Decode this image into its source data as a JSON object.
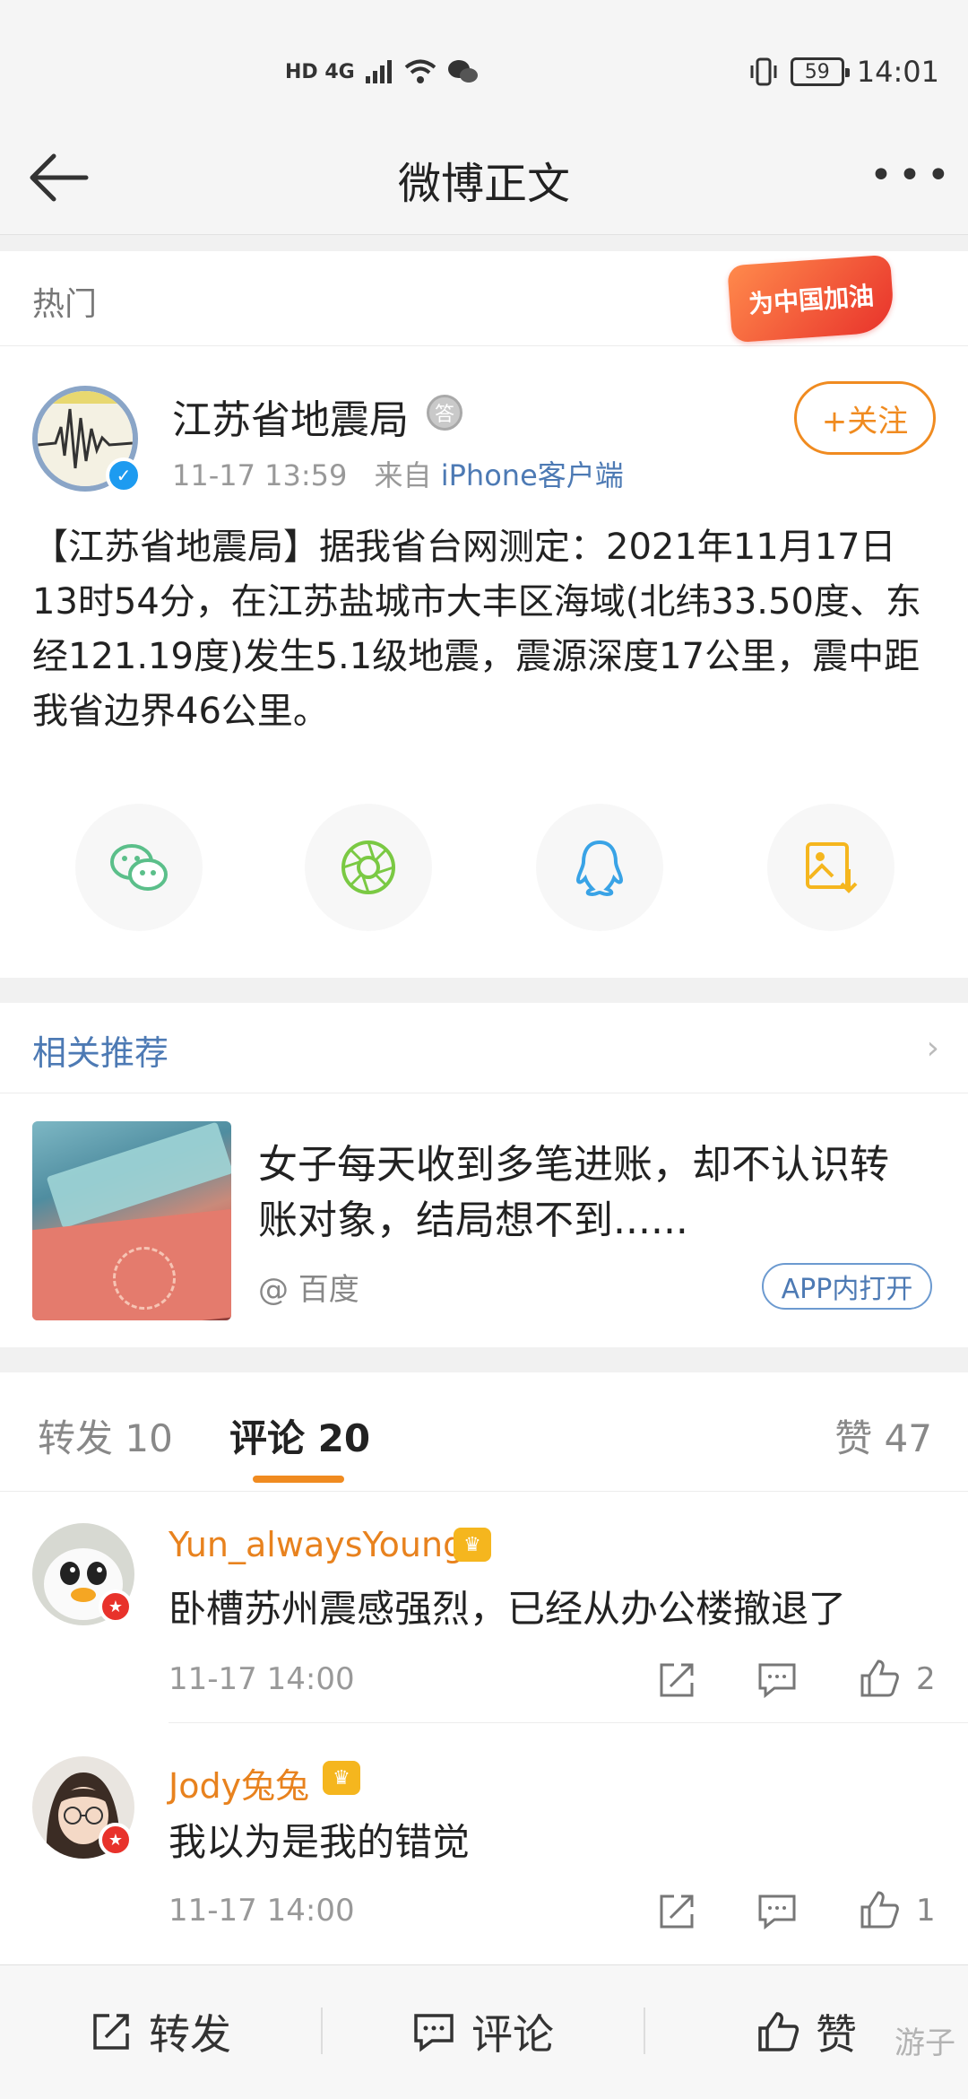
{
  "status_bar": {
    "network": "HD 4G",
    "battery": "59",
    "time": "14:01"
  },
  "header": {
    "title": "微博正文",
    "back_icon": "back-arrow-icon",
    "more_icon": "more-icon"
  },
  "post": {
    "section_label": "热门",
    "badge_text": "为中国加油",
    "author": "江苏省地震局",
    "time": "11-17 13:59",
    "source_prefix": "来自",
    "source": "iPhone客户端",
    "follow_label": "+关注",
    "text": "【江苏省地震局】据我省台网测定：2021年11月17日13时54分，在江苏盐城市大丰区海域(北纬33.50度、东经121.19度)发生5.1级地震，震源深度17公里，震中距我省边界46公里。",
    "share_icons": [
      "wechat-icon",
      "moments-icon",
      "qq-icon",
      "save-image-icon"
    ]
  },
  "related": {
    "title": "相关推荐",
    "headline": "女子每天收到多笔进账，却不认识转账对象，结局想不到......",
    "source": "@ 百度",
    "open_label": "APP内打开"
  },
  "tabs": {
    "repost": "转发 10",
    "comments": "评论 20",
    "likes": "赞 47"
  },
  "comments": [
    {
      "user": "Yun_alwaysYoung",
      "text": "卧槽苏州震感强烈，已经从办公楼撤退了",
      "time": "11-17 14:00",
      "likes": "2"
    },
    {
      "user": "Jody兔兔",
      "text": "我以为是我的错觉",
      "time": "11-17 14:00",
      "likes": "1"
    }
  ],
  "bottom_bar": {
    "repost": "转发",
    "comment": "评论",
    "like": "赞"
  },
  "colors": {
    "accent_orange": "#f08b20",
    "link_blue": "#4d7ab4",
    "username_orange": "#e8821e"
  }
}
